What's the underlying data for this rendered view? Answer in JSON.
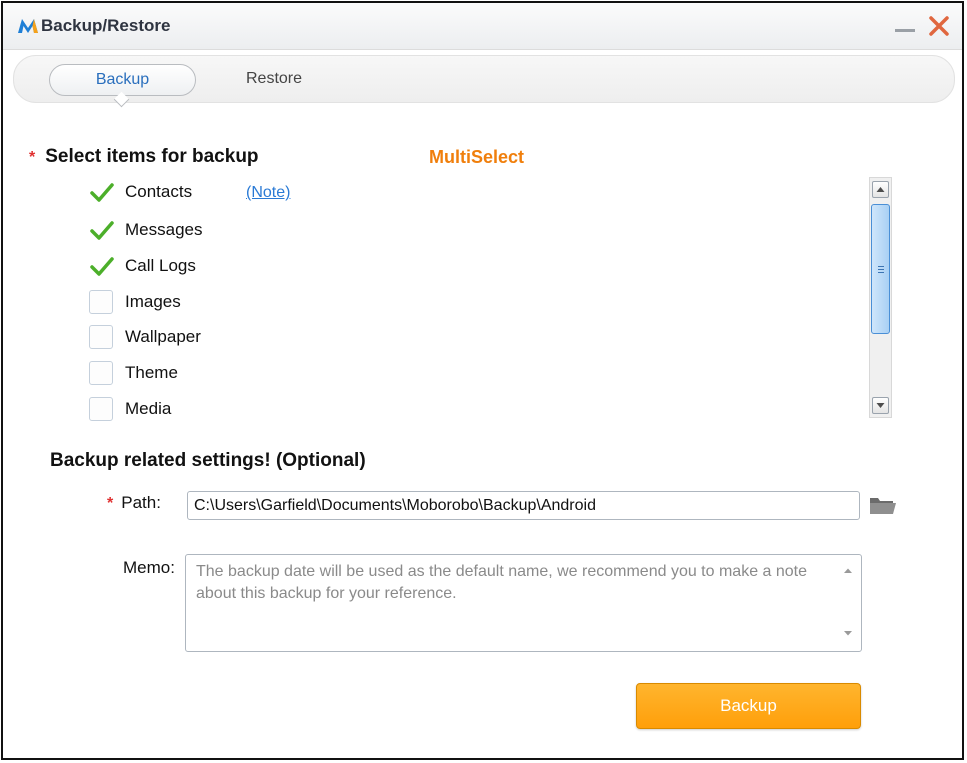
{
  "window": {
    "title": "Backup/Restore"
  },
  "tabs": {
    "backup": "Backup",
    "restore": "Restore"
  },
  "select_section": {
    "required_mark": "*",
    "title": "Select items for backup",
    "multiselect_label": "MultiSelect",
    "note_link": "(Note)",
    "items": [
      {
        "label": "Contacts",
        "checked": true
      },
      {
        "label": "Messages",
        "checked": true
      },
      {
        "label": "Call Logs",
        "checked": true
      },
      {
        "label": "Images",
        "checked": false
      },
      {
        "label": "Wallpaper",
        "checked": false
      },
      {
        "label": "Theme",
        "checked": false
      },
      {
        "label": "Media",
        "checked": false
      }
    ]
  },
  "settings": {
    "title": "Backup related settings! (Optional)",
    "path_required_mark": "*",
    "path_label": "Path:",
    "path_value": "C:\\Users\\Garfield\\Documents\\Moborobo\\Backup\\Android",
    "memo_label": "Memo:",
    "memo_placeholder": "The backup date will be used as the default name, we recommend you to make a note about this backup for your reference."
  },
  "actions": {
    "backup_button": "Backup"
  },
  "colors": {
    "accent_orange": "#ff9f0a",
    "link_blue": "#2a7ad5",
    "check_green": "#4caf2a",
    "required_red": "#e03030"
  }
}
